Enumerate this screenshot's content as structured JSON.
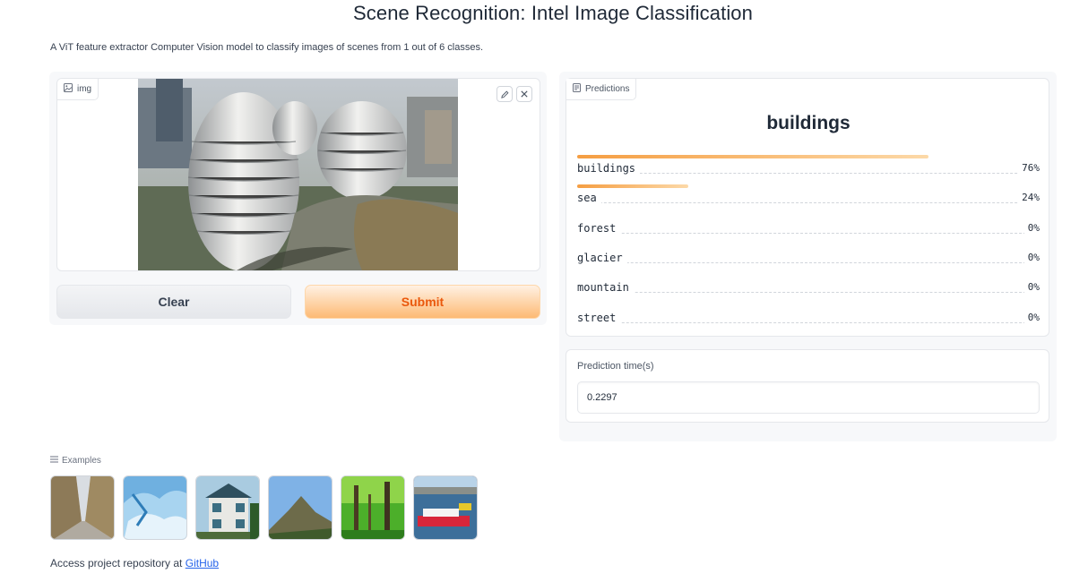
{
  "page": {
    "title": "Scene Recognition: Intel Image Classification",
    "description": "A ViT feature extractor Computer Vision model to classify images of scenes from 1 out of 6 classes."
  },
  "input_panel": {
    "image_label": "img",
    "image_icon": "image-icon",
    "edit_icon": "pencil-icon",
    "close_icon": "close-icon",
    "clear_label": "Clear",
    "submit_label": "Submit"
  },
  "predictions": {
    "label": "Predictions",
    "label_icon": "document-icon",
    "top_class": "buildings",
    "items": [
      {
        "name": "buildings",
        "value": "76%",
        "confidence": 0.76
      },
      {
        "name": "sea",
        "value": "24%",
        "confidence": 0.24
      },
      {
        "name": "forest",
        "value": "0%",
        "confidence": 0
      },
      {
        "name": "glacier",
        "value": "0%",
        "confidence": 0
      },
      {
        "name": "mountain",
        "value": "0%",
        "confidence": 0
      },
      {
        "name": "street",
        "value": "0%",
        "confidence": 0
      }
    ]
  },
  "prediction_time": {
    "label": "Prediction time(s)",
    "value": "0.2297"
  },
  "examples": {
    "label": "Examples",
    "label_icon": "list-icon",
    "items": [
      "street-thumbnail",
      "glacier-thumbnail",
      "buildings-thumbnail",
      "mountain-thumbnail",
      "forest-thumbnail",
      "sea-thumbnail"
    ]
  },
  "footer": {
    "text": "Access project repository at",
    "link_text": "GitHub"
  },
  "colors": {
    "accent_orange": "#ea580c",
    "bar_orange": "#f59e42",
    "link_blue": "#2563eb"
  }
}
